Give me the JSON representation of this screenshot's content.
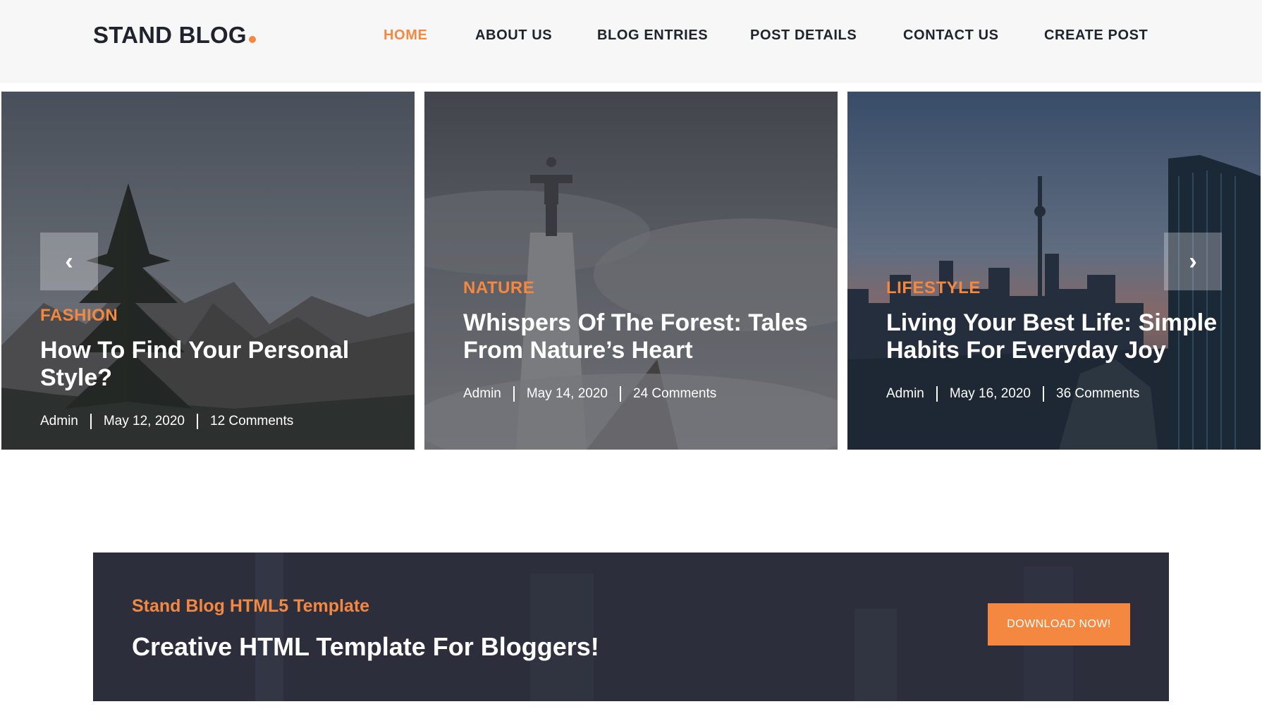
{
  "header": {
    "logo_text": "STAND BLOG",
    "nav": [
      {
        "label": "HOME",
        "active": true
      },
      {
        "label": "ABOUT US",
        "active": false
      },
      {
        "label": "BLOG ENTRIES",
        "active": false
      },
      {
        "label": "POST DETAILS",
        "active": false
      },
      {
        "label": "CONTACT US",
        "active": false
      },
      {
        "label": "CREATE POST",
        "active": false
      }
    ]
  },
  "slider": {
    "prev_icon": "‹",
    "next_icon": "›",
    "slides": [
      {
        "category": "FASHION",
        "title": "How To Find Your Personal Style?",
        "author": "Admin",
        "date": "May 12, 2020",
        "comments": "12 Comments"
      },
      {
        "category": "NATURE",
        "title": "Whispers Of The Forest: Tales From Nature’s Heart",
        "author": "Admin",
        "date": "May 14, 2020",
        "comments": "24 Comments"
      },
      {
        "category": "LIFESTYLE",
        "title": "Living Your Best Life: Simple Habits For Everyday Joy",
        "author": "Admin",
        "date": "May 16, 2020",
        "comments": "36 Comments"
      }
    ]
  },
  "cta": {
    "subtitle": "Stand Blog HTML5 Template",
    "title": "Creative HTML Template For Bloggers!",
    "button": "DOWNLOAD NOW!"
  },
  "colors": {
    "accent": "#f48840",
    "dark": "#20232e",
    "header_bg": "#f7f7f7",
    "cta_bg": "#2c2f3b"
  }
}
